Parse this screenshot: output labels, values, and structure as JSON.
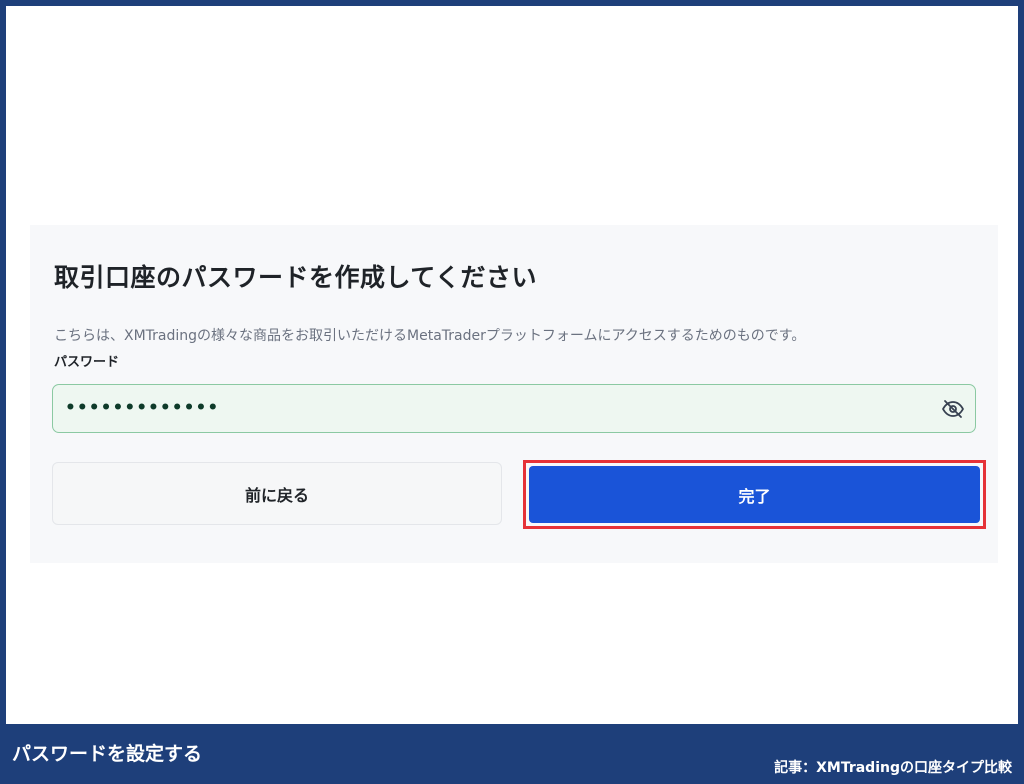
{
  "form": {
    "title": "取引口座のパスワードを作成してください",
    "description": "こちらは、XMTradingの様々な商品をお取引いただけるMetaTraderプラットフォームにアクセスするためのものです。",
    "password_label": "パスワード",
    "password_value": "•••••••••••••",
    "toggle_icon": "eye-slash-icon",
    "back_label": "前に戻る",
    "done_label": "完了"
  },
  "footer": {
    "caption": "パスワードを設定する",
    "article": "記事：XMTradingの口座タイプ比較"
  },
  "colors": {
    "frame": "#1e3f7a",
    "primary_button": "#1a54d8",
    "highlight": "#e53238",
    "input_border": "#8bc9a2"
  }
}
